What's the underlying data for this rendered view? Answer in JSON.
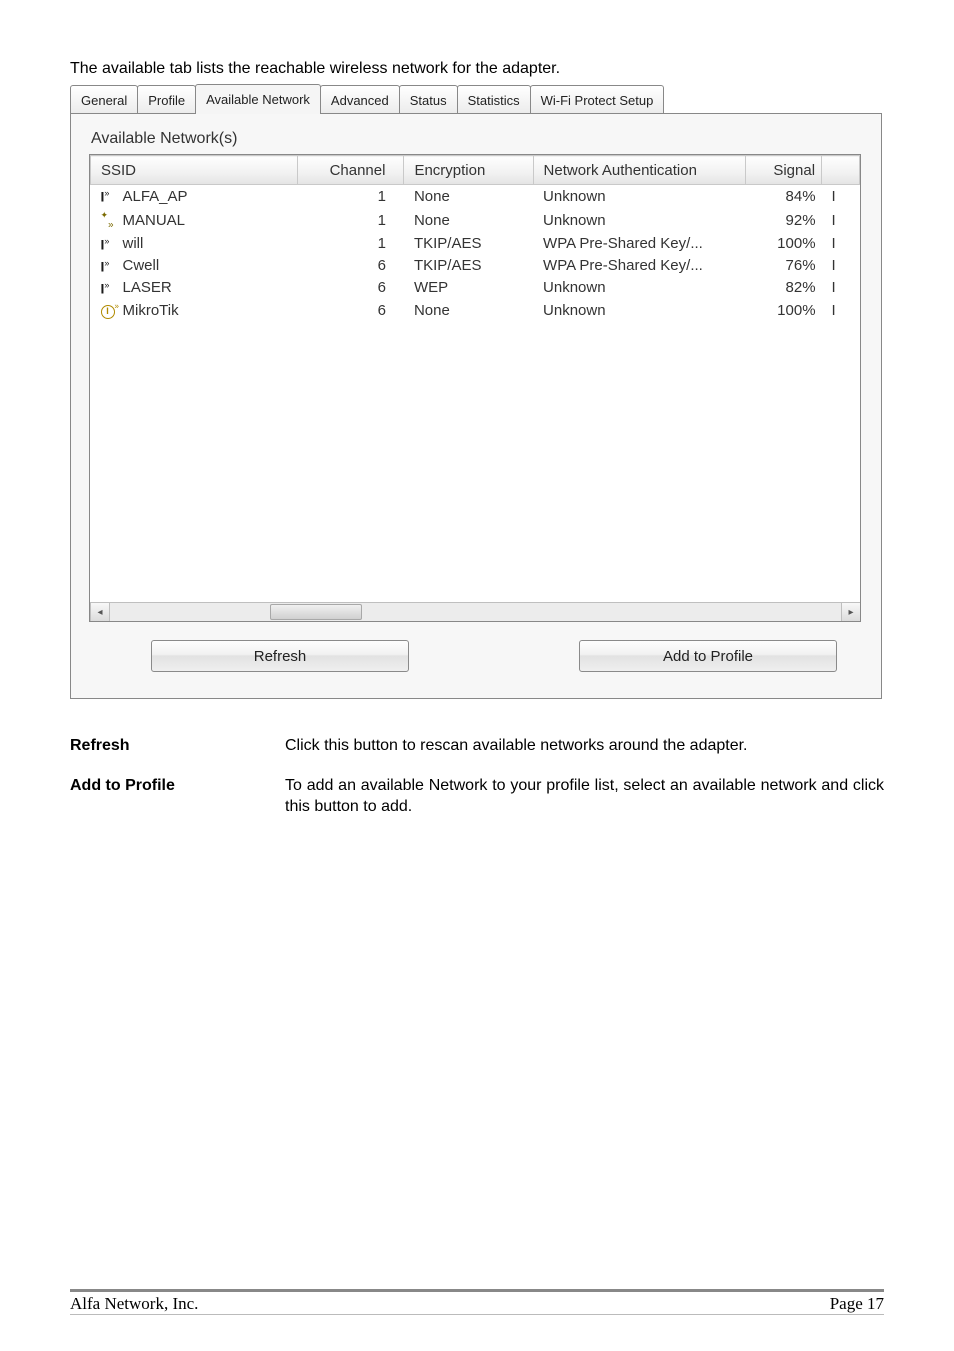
{
  "intro_text": "The available tab lists the reachable wireless network for the adapter.",
  "tabs": {
    "general": "General",
    "profile": "Profile",
    "available_network": "Available Network",
    "advanced": "Advanced",
    "status": "Status",
    "statistics": "Statistics",
    "wps": "Wi-Fi Protect Setup"
  },
  "section_title": "Available Network(s)",
  "columns": {
    "ssid": "SSID",
    "channel": "Channel",
    "encryption": "Encryption",
    "authentication": "Network Authentication",
    "signal": "Signal",
    "extra": ""
  },
  "networks": [
    {
      "icon": "open",
      "ssid": "ALFA_AP",
      "channel": "1",
      "encryption": "None",
      "auth": "Unknown",
      "signal": "84%",
      "extra": "I"
    },
    {
      "icon": "secure",
      "ssid": "MANUAL",
      "channel": "1",
      "encryption": "None",
      "auth": "Unknown",
      "signal": "92%",
      "extra": "I"
    },
    {
      "icon": "open",
      "ssid": "will",
      "channel": "1",
      "encryption": "TKIP/AES",
      "auth": "WPA Pre-Shared Key/...",
      "signal": "100%",
      "extra": "I"
    },
    {
      "icon": "open",
      "ssid": "Cwell",
      "channel": "6",
      "encryption": "TKIP/AES",
      "auth": "WPA Pre-Shared Key/...",
      "signal": "76%",
      "extra": "I"
    },
    {
      "icon": "open",
      "ssid": "LASER",
      "channel": "6",
      "encryption": "WEP",
      "auth": "Unknown",
      "signal": "82%",
      "extra": "I"
    },
    {
      "icon": "circle",
      "ssid": "MikroTik",
      "channel": "6",
      "encryption": "None",
      "auth": "Unknown",
      "signal": "100%",
      "extra": "I"
    }
  ],
  "buttons": {
    "refresh": "Refresh",
    "add_to_profile": "Add to Profile"
  },
  "descriptions": {
    "refresh_label": "Refresh",
    "refresh_text": "Click this button to rescan available networks around the adapter.",
    "add_label": "Add to Profile",
    "add_text": "To add an available Network to your profile list, select an available network and click this button to add."
  },
  "footer": {
    "left": "Alfa Network, Inc.",
    "right": "Page 17"
  }
}
